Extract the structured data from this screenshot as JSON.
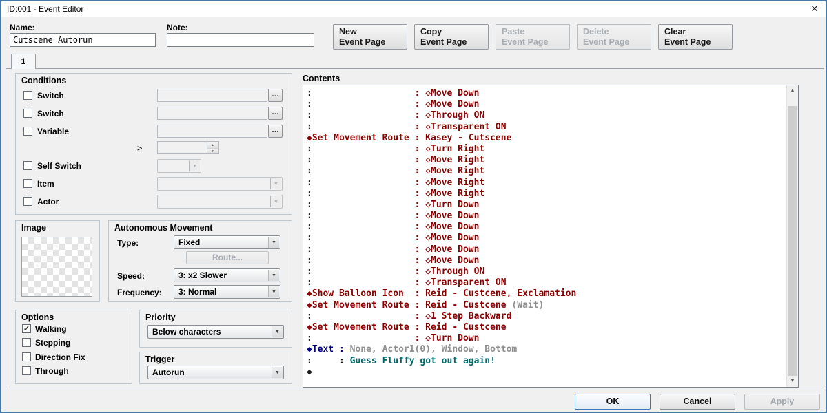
{
  "colors": {
    "k": "#1a1a1a",
    "r": "#8b0000",
    "g": "#8f8f8f",
    "n": "#000080",
    "t": "#006a6a"
  },
  "icons": {
    "close": "✕",
    "dropdown": "▼",
    "spin_up": "▲",
    "spin_down": "▼",
    "scroll_up": "▲",
    "scroll_down": "▼",
    "ellipsis": "…",
    "check": "✓"
  },
  "titlebar": {
    "title": "ID:001 - Event Editor"
  },
  "header": {
    "name_label": "Name:",
    "name_value": "Cutscene Autorun",
    "note_label": "Note:",
    "note_value": ""
  },
  "page_buttons": [
    {
      "line1": "New",
      "line2": "Event Page"
    },
    {
      "line1": "Copy",
      "line2": "Event Page"
    },
    {
      "line1": "Paste",
      "line2": "Event Page"
    },
    {
      "line1": "Delete",
      "line2": "Event Page"
    },
    {
      "line1": "Clear",
      "line2": "Event Page"
    }
  ],
  "tab_label": "1",
  "conditions": {
    "title": "Conditions",
    "switch1_label": "Switch",
    "switch2_label": "Switch",
    "variable_label": "Variable",
    "gte_symbol": "≥",
    "self_switch_label": "Self Switch",
    "item_label": "Item",
    "actor_label": "Actor"
  },
  "image": {
    "title": "Image"
  },
  "autonomous_movement": {
    "title": "Autonomous Movement",
    "type_label": "Type:",
    "type_value": "Fixed",
    "route_button": "Route...",
    "speed_label": "Speed:",
    "speed_value": "3: x2 Slower",
    "frequency_label": "Frequency:",
    "frequency_value": "3: Normal"
  },
  "options": {
    "title": "Options",
    "items": [
      {
        "label": "Walking",
        "checked": true,
        "mark": "✓"
      },
      {
        "label": "Stepping",
        "checked": false,
        "mark": ""
      },
      {
        "label": "Direction Fix",
        "checked": false,
        "mark": ""
      },
      {
        "label": "Through",
        "checked": false,
        "mark": ""
      }
    ]
  },
  "priority": {
    "title": "Priority",
    "value": "Below characters"
  },
  "trigger": {
    "title": "Trigger",
    "value": "Autorun"
  },
  "contents": {
    "title": "Contents",
    "rows": [
      [
        {
          "c": "k",
          "t": ":"
        },
        {
          "c": "r",
          "p": 19,
          "t": ": ◇Move Down"
        }
      ],
      [
        {
          "c": "k",
          "t": ":"
        },
        {
          "c": "r",
          "p": 19,
          "t": ": ◇Move Down"
        }
      ],
      [
        {
          "c": "k",
          "t": ":"
        },
        {
          "c": "r",
          "p": 19,
          "t": ": ◇Through ON"
        }
      ],
      [
        {
          "c": "k",
          "t": ":"
        },
        {
          "c": "r",
          "p": 19,
          "t": ": ◇Transparent ON"
        }
      ],
      [
        {
          "c": "r",
          "t": "◆Set Movement Route : Kasey - Cutscene"
        }
      ],
      [
        {
          "c": "k",
          "t": ":"
        },
        {
          "c": "r",
          "p": 19,
          "t": ": ◇Turn Right"
        }
      ],
      [
        {
          "c": "k",
          "t": ":"
        },
        {
          "c": "r",
          "p": 19,
          "t": ": ◇Move Right"
        }
      ],
      [
        {
          "c": "k",
          "t": ":"
        },
        {
          "c": "r",
          "p": 19,
          "t": ": ◇Move Right"
        }
      ],
      [
        {
          "c": "k",
          "t": ":"
        },
        {
          "c": "r",
          "p": 19,
          "t": ": ◇Move Right"
        }
      ],
      [
        {
          "c": "k",
          "t": ":"
        },
        {
          "c": "r",
          "p": 19,
          "t": ": ◇Move Right"
        }
      ],
      [
        {
          "c": "k",
          "t": ":"
        },
        {
          "c": "r",
          "p": 19,
          "t": ": ◇Turn Down"
        }
      ],
      [
        {
          "c": "k",
          "t": ":"
        },
        {
          "c": "r",
          "p": 19,
          "t": ": ◇Move Down"
        }
      ],
      [
        {
          "c": "k",
          "t": ":"
        },
        {
          "c": "r",
          "p": 19,
          "t": ": ◇Move Down"
        }
      ],
      [
        {
          "c": "k",
          "t": ":"
        },
        {
          "c": "r",
          "p": 19,
          "t": ": ◇Move Down"
        }
      ],
      [
        {
          "c": "k",
          "t": ":"
        },
        {
          "c": "r",
          "p": 19,
          "t": ": ◇Move Down"
        }
      ],
      [
        {
          "c": "k",
          "t": ":"
        },
        {
          "c": "r",
          "p": 19,
          "t": ": ◇Move Down"
        }
      ],
      [
        {
          "c": "k",
          "t": ":"
        },
        {
          "c": "r",
          "p": 19,
          "t": ": ◇Through ON"
        }
      ],
      [
        {
          "c": "k",
          "t": ":"
        },
        {
          "c": "r",
          "p": 19,
          "t": ": ◇Transparent ON"
        }
      ],
      [
        {
          "c": "r",
          "t": "◆Show Balloon Icon  : Reid - Custcene, Exclamation"
        }
      ],
      [
        {
          "c": "r",
          "t": "◆Set Movement Route : Reid - Custcene"
        },
        {
          "c": "g",
          "t": " (Wait)"
        }
      ],
      [
        {
          "c": "k",
          "t": ":"
        },
        {
          "c": "r",
          "p": 19,
          "t": ": ◇1 Step Backward"
        }
      ],
      [
        {
          "c": "r",
          "t": "◆Set Movement Route : Reid - Custcene"
        }
      ],
      [
        {
          "c": "k",
          "t": ":"
        },
        {
          "c": "r",
          "p": 19,
          "t": ": ◇Turn Down"
        }
      ],
      [
        {
          "c": "n",
          "t": "◆Text : "
        },
        {
          "c": "g",
          "t": "None, Actor1(0), Window, Bottom"
        }
      ],
      [
        {
          "c": "k",
          "t": ":"
        },
        {
          "c": "k",
          "p": 5,
          "t": ": "
        },
        {
          "c": "t",
          "t": "Guess Fluffy got out again!"
        }
      ],
      [
        {
          "c": "k",
          "t": "◆"
        }
      ]
    ]
  },
  "footer": {
    "ok": "OK",
    "cancel": "Cancel",
    "apply": "Apply"
  }
}
